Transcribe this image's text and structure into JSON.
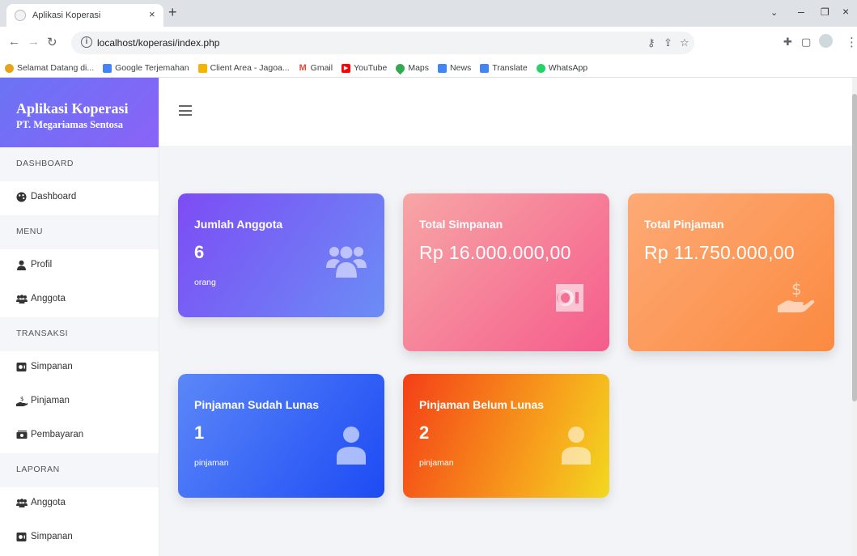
{
  "browser": {
    "tab_title": "Aplikasi Koperasi",
    "tab_close": "×",
    "new_tab": "+",
    "url": "localhost/koperasi/index.php",
    "bookmarks": [
      {
        "label": "Selamat Datang di...",
        "color": "#e8a317"
      },
      {
        "label": "Google Terjemahan",
        "color": "#4285f4"
      },
      {
        "label": "Client Area - Jagoa...",
        "color": "#f4b400"
      },
      {
        "label": "Gmail",
        "color": "#ea4335"
      },
      {
        "label": "YouTube",
        "color": "#ff0000"
      },
      {
        "label": "Maps",
        "color": "#34a853"
      },
      {
        "label": "News",
        "color": "#4285f4"
      },
      {
        "label": "Translate",
        "color": "#4285f4"
      },
      {
        "label": "WhatsApp",
        "color": "#25d366"
      }
    ]
  },
  "brand": {
    "title": "Aplikasi Koperasi",
    "subtitle": "PT. Megariamas Sentosa"
  },
  "sidebar": {
    "dashboard_head": "DASHBOARD",
    "dashboard": "Dashboard",
    "menu_head": "MENU",
    "profil": "Profil",
    "anggota": "Anggota",
    "transaksi_head": "TRANSAKSI",
    "simpanan": "Simpanan",
    "pinjaman": "Pinjaman",
    "pembayaran": "Pembayaran",
    "laporan_head": "LAPORAN",
    "lap_anggota": "Anggota",
    "lap_simpanan": "Simpanan"
  },
  "cards": {
    "anggota": {
      "label": "Jumlah Anggota",
      "value": "6",
      "unit": "orang"
    },
    "simpanan": {
      "label": "Total Simpanan",
      "value": "Rp 16.000.000,00"
    },
    "pinjaman": {
      "label": "Total Pinjaman",
      "value": "Rp 11.750.000,00"
    },
    "lunas": {
      "label": "Pinjaman Sudah Lunas",
      "value": "1",
      "unit": "pinjaman"
    },
    "belum": {
      "label": "Pinjaman Belum Lunas",
      "value": "2",
      "unit": "pinjaman"
    }
  }
}
